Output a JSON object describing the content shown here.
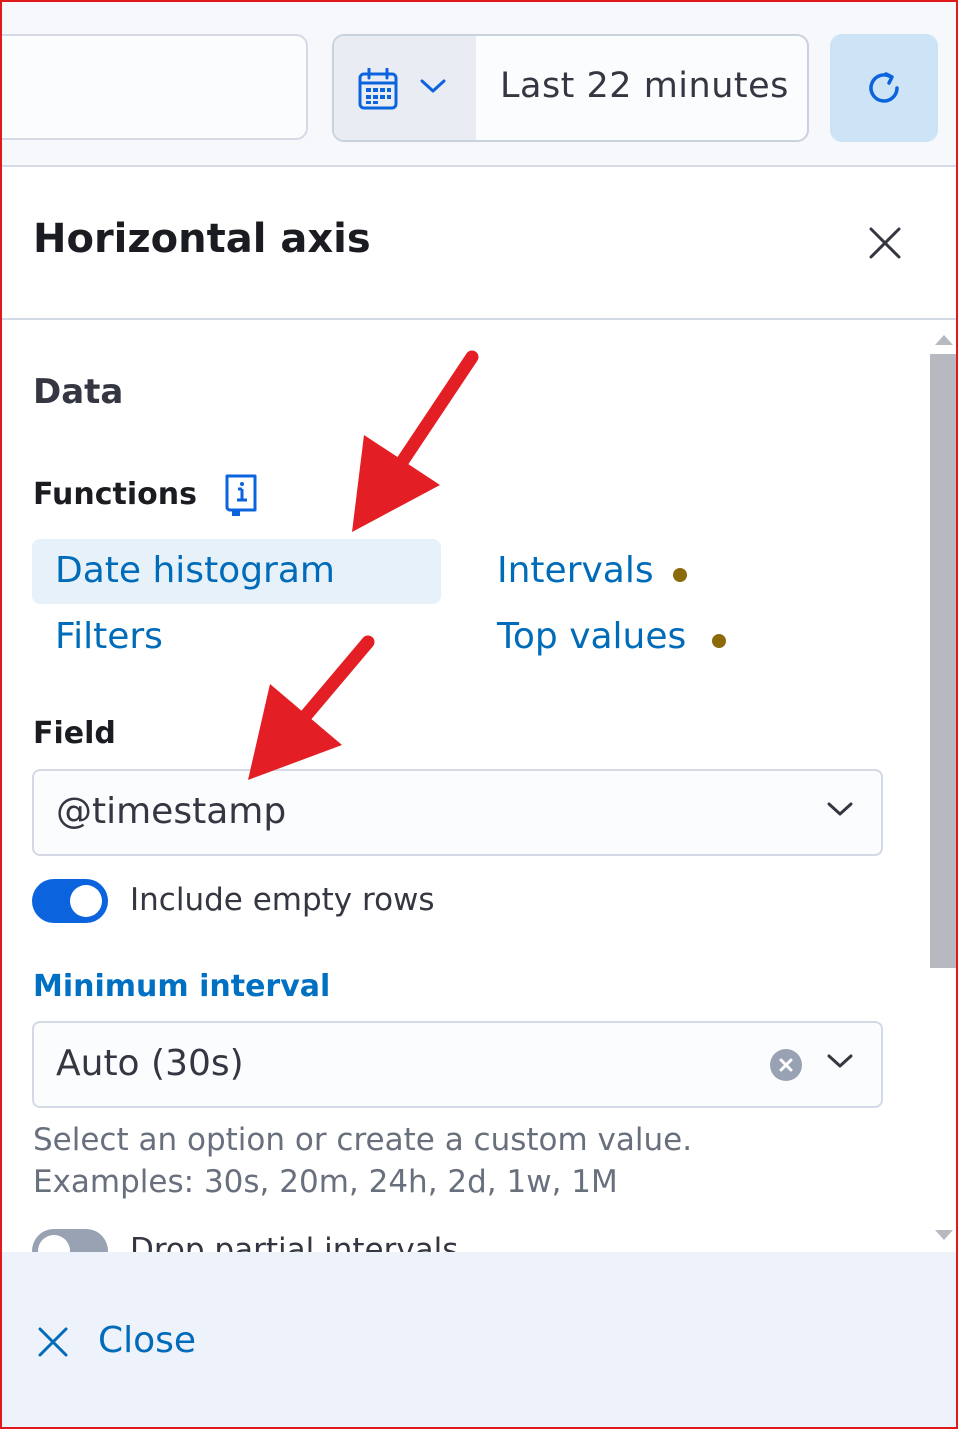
{
  "toolbar": {
    "date_range_label": "Last 22 minutes",
    "quick_menu_icon": "calendar-icon",
    "refresh_icon": "refresh-icon"
  },
  "flyout": {
    "title": "Horizontal axis",
    "section_title": "Data",
    "functions_label": "Functions",
    "functions": [
      {
        "label": "Date histogram",
        "selected": true,
        "has_dot": false
      },
      {
        "label": "Intervals",
        "selected": false,
        "has_dot": true
      },
      {
        "label": "Filters",
        "selected": false,
        "has_dot": false
      },
      {
        "label": "Top values",
        "selected": false,
        "has_dot": true
      }
    ],
    "field_label": "Field",
    "field_value": "@timestamp",
    "include_empty_rows_label": "Include empty rows",
    "include_empty_rows": true,
    "minimum_interval_label": "Minimum interval",
    "minimum_interval_value": "Auto (30s)",
    "help_line_1": "Select an option or create a custom value.",
    "help_line_2": "Examples: 30s, 20m, 24h, 2d, 1w, 1M",
    "drop_partial_label": "Drop partial intervals",
    "drop_partial": false,
    "footer_close_label": "Close"
  },
  "colors": {
    "accent": "#006bb8",
    "annotation_arrow": "#e31e24",
    "dot": "#8a6a0a",
    "toggle_on": "#0b64dd",
    "toggle_off": "#98a2b3"
  }
}
